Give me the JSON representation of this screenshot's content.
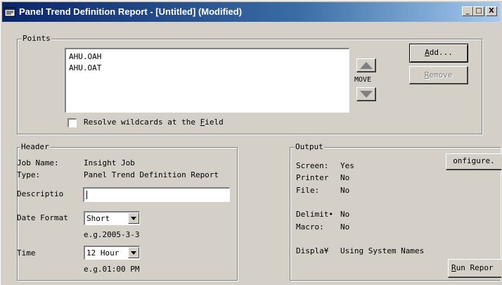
{
  "window": {
    "title": "Panel Trend Definition Report - [Untitled] (Modified)"
  },
  "titlebar": {
    "minimize": "_",
    "maximize": "□",
    "close": "X"
  },
  "points": {
    "legend": "Points",
    "items": [
      "AHU.OAH",
      "AHU.OAT"
    ],
    "move_label": "MOVE",
    "add_label_pre": "",
    "add_label_u": "A",
    "add_label_post": "dd...",
    "remove_label_u": "R",
    "remove_label_post": "emove",
    "wildcards_pre": "Resolve wildcards at the ",
    "wildcards_u": "F",
    "wildcards_post": "ield"
  },
  "header": {
    "legend": "Header",
    "job_name_label": "Job Name:",
    "job_name_value": "Insight Job",
    "type_label": "Type:",
    "type_value": "Panel Trend Definition Report",
    "description_label": "Descriptio",
    "description_value": "",
    "date_format_label": "Date Format",
    "date_format_value": "Short",
    "date_example": "e.g.2005-3-3",
    "time_label": "Time",
    "time_value": "12 Hour",
    "time_example": "e.g.01:00 PM"
  },
  "output": {
    "legend": "Output",
    "configure_label": "onfigure.",
    "screen_label": "Screen:",
    "screen_value": "Yes",
    "printer_label": "Printer",
    "printer_value": "No",
    "file_label": "File:",
    "file_value": "No",
    "delimit_label": "Delimit•",
    "delimit_value": "No",
    "macro_label": "Macro:",
    "macro_value": "No",
    "display_label": "Displa¥",
    "display_value": "Using System Names",
    "run_label_u": "R",
    "run_label_post": "un Repor"
  },
  "colors": {
    "face": "#d4d0c8",
    "title_start": "#0a246a",
    "title_end": "#a6caf0"
  }
}
